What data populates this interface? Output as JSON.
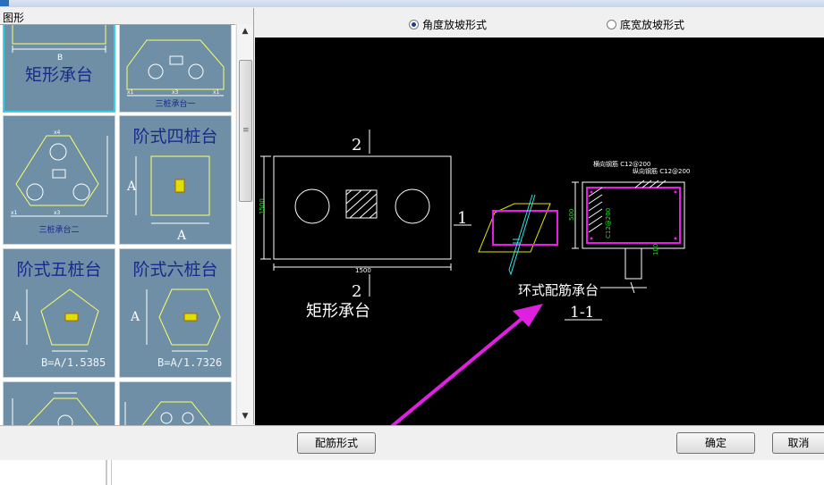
{
  "window": {
    "title": ""
  },
  "left_panel": {
    "group_label": "图形",
    "thumbnails": [
      {
        "title": "矩形承台",
        "caption": "",
        "formula": ""
      },
      {
        "title": "",
        "caption": "三桩承台一",
        "formula": ""
      },
      {
        "title": "",
        "caption": "三桩承台二",
        "formula": ""
      },
      {
        "title": "阶式四桩台",
        "caption": "",
        "formula": ""
      },
      {
        "title": "阶式五桩台",
        "caption": "",
        "formula": "B=A/1.5385"
      },
      {
        "title": "阶式六桩台",
        "caption": "",
        "formula": "B=A/1.7326"
      },
      {
        "title": "",
        "caption": "",
        "formula": ""
      },
      {
        "title": "",
        "caption": "",
        "formula": ""
      }
    ],
    "selected_index": 0
  },
  "mode_options": [
    {
      "label": "角度放坡形式",
      "checked": true
    },
    {
      "label": "底宽放坡形式",
      "checked": false
    }
  ],
  "preview": {
    "section_mark_top": "2",
    "section_mark_bottom": "2",
    "section_mark_right": "1",
    "dim_height": "1500",
    "dim_width": "1500",
    "plan_title": "矩形承台",
    "rebar_horizontal": "横向钢筋 C12@200",
    "rebar_vertical": "纵向钢筋 C12@200",
    "rebar_side": "C12@200",
    "dim_depth": "500",
    "dim_small": "100",
    "ring_title": "环式配筋承台",
    "section_title": "1-1",
    "colors": {
      "outline": "#ffffff",
      "rebar": "#e81be8",
      "dim": "#22dd22",
      "slope": "#e4e400",
      "axis": "#2ee6e6",
      "arrow": "#e020e0"
    }
  },
  "buttons": {
    "rebar_form": "配筋形式",
    "ok": "确定",
    "cancel": "取消"
  }
}
